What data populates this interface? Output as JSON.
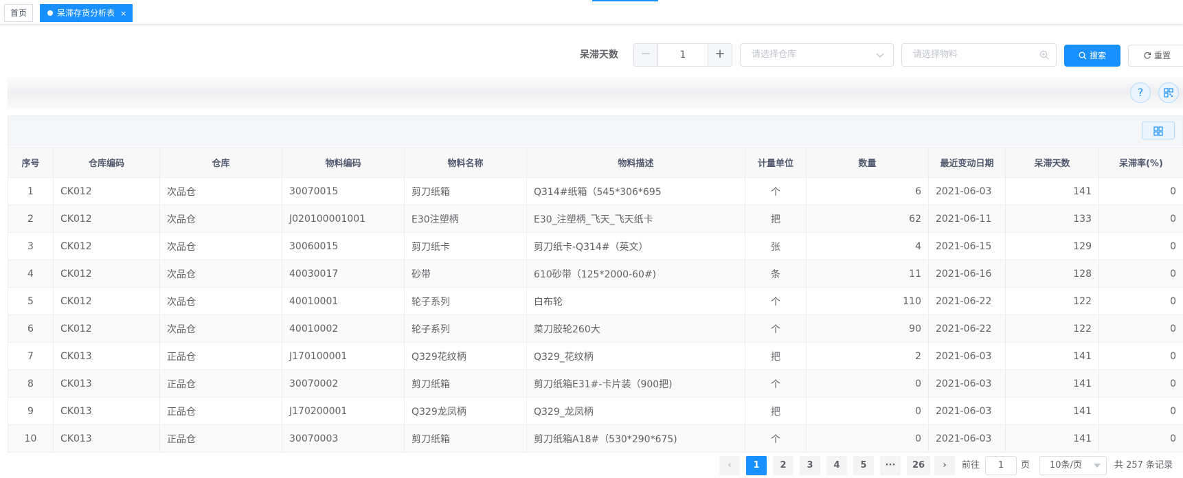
{
  "tabs": {
    "home": "首页",
    "active": "呆滞存货分析表",
    "close": "×"
  },
  "search": {
    "days_label": "呆滞天数",
    "days_minus": "−",
    "days_value": "1",
    "days_plus": "+",
    "warehouse_placeholder": "请选择仓库",
    "material_placeholder": "请选择物料",
    "search_button": "搜索",
    "reset_button": "重置"
  },
  "toolbar": {
    "help": "?"
  },
  "table": {
    "headers": [
      "序号",
      "仓库编码",
      "仓库",
      "物料编码",
      "物料名称",
      "物料描述",
      "计量单位",
      "数量",
      "最近变动日期",
      "呆滞天数",
      "呆滞率(%)"
    ],
    "rows": [
      [
        "1",
        "CK012",
        "次品仓",
        "30070015",
        "剪刀纸箱",
        "Q314#纸箱（545*306*695",
        "个",
        "6",
        "2021-06-03",
        "141",
        "0"
      ],
      [
        "2",
        "CK012",
        "次品仓",
        "J020100001001",
        "E30注塑柄",
        "E30_注塑柄_飞天_飞天纸卡",
        "把",
        "62",
        "2021-06-11",
        "133",
        "0"
      ],
      [
        "3",
        "CK012",
        "次品仓",
        "30060015",
        "剪刀纸卡",
        "剪刀纸卡-Q314#（英文）",
        "张",
        "4",
        "2021-06-15",
        "129",
        "0"
      ],
      [
        "4",
        "CK012",
        "次品仓",
        "40030017",
        "砂带",
        "610砂带（125*2000-60#)",
        "条",
        "11",
        "2021-06-16",
        "128",
        "0"
      ],
      [
        "5",
        "CK012",
        "次品仓",
        "40010001",
        "轮子系列",
        "白布轮",
        "个",
        "110",
        "2021-06-22",
        "122",
        "0"
      ],
      [
        "6",
        "CK012",
        "次品仓",
        "40010002",
        "轮子系列",
        "菜刀胶轮260大",
        "个",
        "90",
        "2021-06-22",
        "122",
        "0"
      ],
      [
        "7",
        "CK013",
        "正品仓",
        "J170100001",
        "Q329花纹柄",
        "Q329_花纹柄",
        "把",
        "2",
        "2021-06-03",
        "141",
        "0"
      ],
      [
        "8",
        "CK013",
        "正品仓",
        "30070002",
        "剪刀纸箱",
        "剪刀纸箱E31#-卡片装（900把)",
        "个",
        "0",
        "2021-06-03",
        "141",
        "0"
      ],
      [
        "9",
        "CK013",
        "正品仓",
        "J170200001",
        "Q329龙凤柄",
        "Q329_龙凤柄",
        "把",
        "0",
        "2021-06-03",
        "141",
        "0"
      ],
      [
        "10",
        "CK013",
        "正品仓",
        "30070003",
        "剪刀纸箱",
        "剪刀纸箱A18#（530*290*675)",
        "个",
        "0",
        "2021-06-03",
        "141",
        "0"
      ]
    ]
  },
  "pagination": {
    "prev": "‹",
    "pages": [
      "1",
      "2",
      "3",
      "4",
      "5",
      "···",
      "26"
    ],
    "current": "1",
    "next": "›",
    "goto_label": "前往",
    "goto_value": "1",
    "page_suffix": "页",
    "page_size": "10条/页",
    "total": "共 257 条记录"
  },
  "colors": {
    "primary": "#1890ff"
  }
}
